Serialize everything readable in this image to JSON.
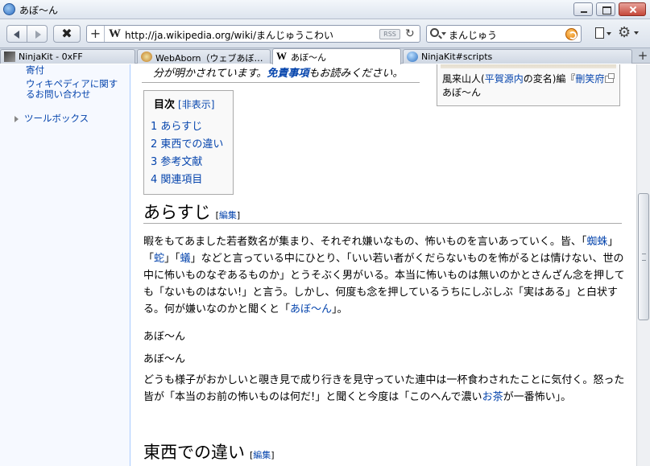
{
  "window": {
    "title": "あぼ〜ん"
  },
  "nav": {
    "url": "http://ja.wikipedia.org/wiki/まんじゅうこわい",
    "rss_label": "RSS",
    "search_value": "まんじゅう",
    "add_glyph": "+",
    "favicon_glyph": "W",
    "reload_glyph": "↻",
    "stop_glyph": "✖",
    "gear_glyph": "⚙"
  },
  "tabs": [
    {
      "label": "NinjaKit - 0xFF",
      "icon": "ninja-icon"
    },
    {
      "label": "WebAborn（ウェブあぼ…",
      "icon": "webaborn-icon"
    },
    {
      "label": "あぼ〜ん",
      "icon": "wikipedia-icon",
      "active": true,
      "icon_glyph": "W"
    },
    {
      "label": "NinjaKit#scripts",
      "icon": "globe-icon"
    }
  ],
  "new_tab_glyph": "+",
  "sidebar": {
    "donate": "寄付",
    "contact": "ウィキペディアに関するお問い合わせ",
    "toolbox": "ツールボックス"
  },
  "article": {
    "disclaimer_pre": "分が明かされています。",
    "disclaimer_link": "免責事項",
    "disclaimer_post": "もお読みください。",
    "infobox": {
      "c1": "風来山人(",
      "c2": "平賀源内",
      "c3": "の変名)編『",
      "c4": "刪笑府",
      "c5": "あぼ〜ん"
    },
    "toc": {
      "title": "目次",
      "toggle": "[非表示]",
      "items": [
        "1 あらすじ",
        "2 東西での違い",
        "3 参考文献",
        "4 関連項目"
      ]
    },
    "section1": {
      "title": "あらすじ",
      "edit_open": "[",
      "edit": "編集",
      "edit_close": "]"
    },
    "section2": {
      "title": "東西での違い",
      "edit_open": "[",
      "edit": "編集",
      "edit_close": "]"
    },
    "p1": {
      "t1": "暇をもてあました若者数名が集まり、それぞれ嫌いなもの、怖いものを言いあっていく。皆、「",
      "l1": "蜘蛛",
      "t2": "」「",
      "l2": "蛇",
      "t3": "」「",
      "l3": "蟻",
      "t4": "」などと言っている中にひとり、「いい若い者がくだらないものを怖がるとは情けない、世の中に怖いものなぞあるものか」とうそぶく男がいる。本当に怖いものは無いのかとさんざん念を押しても「ないものはない!」と言う。しかし、何度も念を押しているうちにしぶしぶ「実はある」と白状する。何が嫌いなのかと聞くと「",
      "l4": "あぼ〜ん",
      "t5": "」。"
    },
    "p2": "あぼ〜ん",
    "p3": "あぼ〜ん",
    "p4": {
      "t1": "どうも様子がおかしいと覗き見で成り行きを見守っていた連中は一杯食わされたことに気付く。怒った皆が「本当のお前の怖いものは何だ!」と聞くと今度は「このへんで濃い",
      "l1": "お茶",
      "t2": "が一番怖い」。"
    }
  },
  "colors": {
    "link": "#0645ad",
    "sidebar_bg": "#f6f9ff",
    "toolbar_bg": "#dbe2ec"
  }
}
